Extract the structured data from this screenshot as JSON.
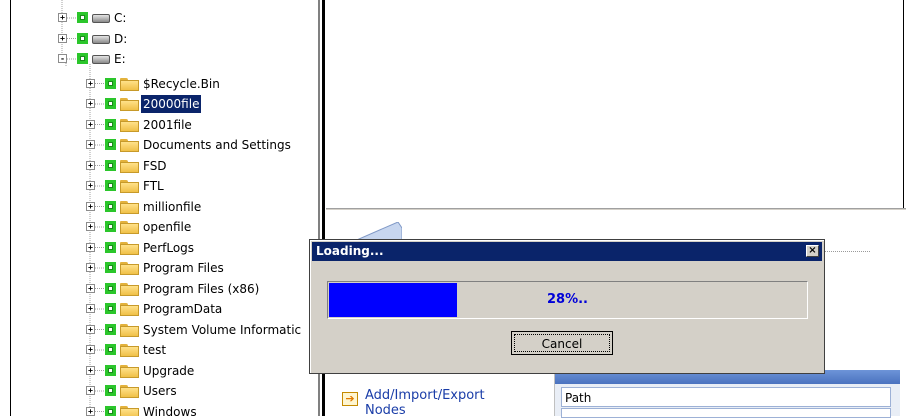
{
  "tree": {
    "drives": [
      {
        "label": "C:",
        "expander": "+"
      },
      {
        "label": "D:",
        "expander": "+"
      },
      {
        "label": "E:",
        "expander": "-"
      }
    ],
    "folders": [
      {
        "label": "$Recycle.Bin",
        "selected": false
      },
      {
        "label": "20000file",
        "selected": true
      },
      {
        "label": "2001file",
        "selected": false
      },
      {
        "label": "Documents and Settings",
        "selected": false
      },
      {
        "label": "FSD",
        "selected": false
      },
      {
        "label": "FTL",
        "selected": false
      },
      {
        "label": "millionfile",
        "selected": false
      },
      {
        "label": "openfile",
        "selected": false
      },
      {
        "label": "PerfLogs",
        "selected": false
      },
      {
        "label": "Program Files",
        "selected": false
      },
      {
        "label": "Program Files (x86)",
        "selected": false
      },
      {
        "label": "ProgramData",
        "selected": false
      },
      {
        "label": "System Volume Informatic",
        "selected": false
      },
      {
        "label": "test",
        "selected": false
      },
      {
        "label": "Upgrade",
        "selected": false
      },
      {
        "label": "Users",
        "selected": false
      },
      {
        "label": "Windows",
        "selected": false
      }
    ]
  },
  "dialog": {
    "title": "Loading...",
    "close_glyph": "×",
    "progress_percent": 28,
    "progress_text": "28%..",
    "cancel_label": "Cancel"
  },
  "lower_panel": {
    "link_line1": "Add/Import/Export",
    "link_line2": "Nodes",
    "grid_cell": "Path"
  },
  "colors": {
    "selection": "#0a246a",
    "progress_fill": "#0000ff",
    "progress_text": "#0000d8",
    "checkbox": "#2bc62b",
    "link": "#1a3da8"
  }
}
